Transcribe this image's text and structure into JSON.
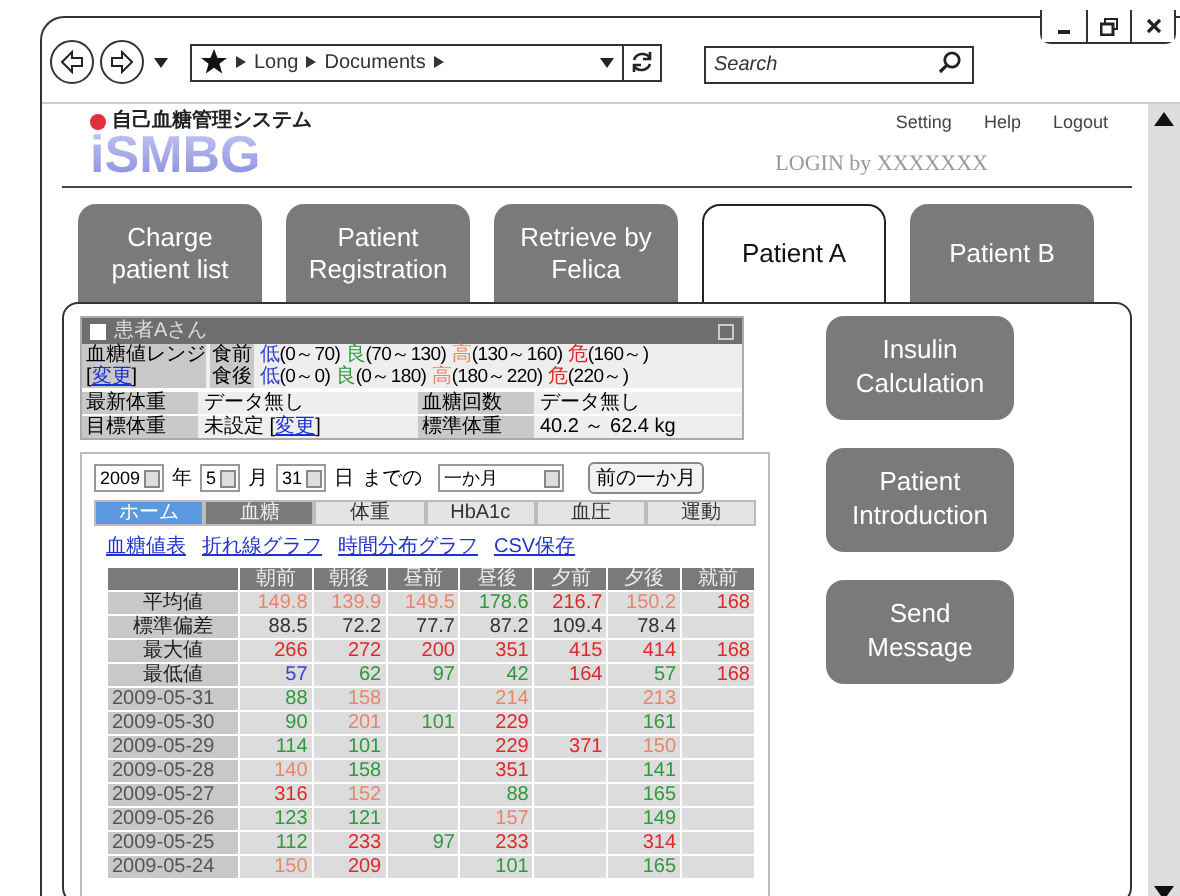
{
  "browser": {
    "breadcrumb": [
      "Long",
      "Documents"
    ],
    "search": {
      "placeholder": "Search"
    }
  },
  "header": {
    "subtitle": "自己血糖管理システム",
    "logo": "iSMBG",
    "links": [
      "Setting",
      "Help",
      "Logout"
    ],
    "login": "LOGIN by XXXXXXX"
  },
  "tabs": [
    {
      "label": "Charge patient list",
      "selected": false
    },
    {
      "label": "Patient Registration",
      "selected": false
    },
    {
      "label": "Retrieve by Felica",
      "selected": false
    },
    {
      "label": "Patient A",
      "selected": true
    },
    {
      "label": "Patient B",
      "selected": false
    }
  ],
  "patient_card": {
    "title": "患者Aさん",
    "range_label": "血糖値レンジ",
    "range_link": {
      "before": "[",
      "link": "変更",
      "after": "]"
    },
    "range_rows": [
      {
        "meal": "食前",
        "bands": [
          {
            "label": "低",
            "span": "(0～70)",
            "color": "#3344cc"
          },
          {
            "label": "良",
            "span": "(70～130)",
            "color": "#2e9a3a"
          },
          {
            "label": "高",
            "span": "(130～160)",
            "color": "#e8866a"
          },
          {
            "label": "危",
            "span": "(160～)",
            "color": "#e02828"
          }
        ]
      },
      {
        "meal": "食後",
        "bands": [
          {
            "label": "低",
            "span": "(0～0)",
            "color": "#3344cc"
          },
          {
            "label": "良",
            "span": "(0～180)",
            "color": "#2e9a3a"
          },
          {
            "label": "高",
            "span": "(180～220)",
            "color": "#e8866a"
          },
          {
            "label": "危",
            "span": "(220～)",
            "color": "#e02828"
          }
        ]
      }
    ],
    "info_rows": [
      {
        "label": "最新体重",
        "value": "データ無し",
        "label_2": "血糖回数",
        "value_2": "データ無し"
      },
      {
        "label": "目標体重",
        "value": "未設定",
        "link": {
          "before": "[",
          "link": "変更",
          "after": "]"
        },
        "label_2": "標準体重",
        "value_2": "40.2 ～ 62.4 kg"
      }
    ]
  },
  "date_filter": {
    "year": "2009",
    "year_unit": "年",
    "month": "5",
    "month_unit": "月",
    "day": "31",
    "day_unit": "日",
    "until": "までの",
    "period": "一か月",
    "prev_button": "前の一か月"
  },
  "sub_tabs": [
    {
      "label": "ホーム",
      "selected": false,
      "highlighted": true
    },
    {
      "label": "血糖",
      "selected": true,
      "highlighted": false
    },
    {
      "label": "体重",
      "selected": false,
      "highlighted": false
    },
    {
      "label": "HbA1c",
      "selected": false,
      "highlighted": false
    },
    {
      "label": "血圧",
      "selected": false,
      "highlighted": false
    },
    {
      "label": "運動",
      "selected": false,
      "highlighted": false
    }
  ],
  "view_links": [
    "血糖値表",
    "折れ線グラフ",
    "時間分布グラフ",
    "CSV保存"
  ],
  "table": {
    "columns": [
      "朝前",
      "朝後",
      "昼前",
      "昼後",
      "夕前",
      "夕後",
      "就前"
    ],
    "rows": [
      {
        "kind": "stat",
        "label": "平均値",
        "cells": [
          {
            "text": "149.8",
            "color": "#e8866a"
          },
          {
            "text": "139.9",
            "color": "#e8866a"
          },
          {
            "text": "149.5",
            "color": "#e8866a"
          },
          {
            "text": "178.6",
            "color": "#2e9a3a"
          },
          {
            "text": "216.7",
            "color": "#e02828"
          },
          {
            "text": "150.2",
            "color": "#e8866a"
          },
          {
            "text": "168",
            "color": "#e02828"
          }
        ]
      },
      {
        "kind": "stat",
        "label": "標準偏差",
        "cells": [
          {
            "text": "88.5",
            "color": "#333333"
          },
          {
            "text": "72.2",
            "color": "#333333"
          },
          {
            "text": "77.7",
            "color": "#333333"
          },
          {
            "text": "87.2",
            "color": "#333333"
          },
          {
            "text": "109.4",
            "color": "#333333"
          },
          {
            "text": "78.4",
            "color": "#333333"
          },
          null
        ]
      },
      {
        "kind": "stat",
        "label": "最大値",
        "cells": [
          {
            "text": "266",
            "color": "#e02828"
          },
          {
            "text": "272",
            "color": "#e02828"
          },
          {
            "text": "200",
            "color": "#e02828"
          },
          {
            "text": "351",
            "color": "#e02828"
          },
          {
            "text": "415",
            "color": "#e02828"
          },
          {
            "text": "414",
            "color": "#e02828"
          },
          {
            "text": "168",
            "color": "#e02828"
          }
        ]
      },
      {
        "kind": "stat",
        "label": "最低値",
        "cells": [
          {
            "text": "57",
            "color": "#3344cc"
          },
          {
            "text": "62",
            "color": "#2e9a3a"
          },
          {
            "text": "97",
            "color": "#2e9a3a"
          },
          {
            "text": "42",
            "color": "#2e9a3a"
          },
          {
            "text": "164",
            "color": "#e02828"
          },
          {
            "text": "57",
            "color": "#2e9a3a"
          },
          {
            "text": "168",
            "color": "#e02828"
          }
        ]
      },
      {
        "kind": "day",
        "label": "2009-05-31",
        "cells": [
          {
            "text": "88",
            "color": "#2e9a3a"
          },
          {
            "text": "158",
            "color": "#e8866a"
          },
          null,
          {
            "text": "214",
            "color": "#e8866a"
          },
          null,
          {
            "text": "213",
            "color": "#e8866a"
          },
          null
        ]
      },
      {
        "kind": "day",
        "label": "2009-05-30",
        "cells": [
          {
            "text": "90",
            "color": "#2e9a3a"
          },
          {
            "text": "201",
            "color": "#e8866a"
          },
          {
            "text": "101",
            "color": "#2e9a3a"
          },
          {
            "text": "229",
            "color": "#e02828"
          },
          null,
          {
            "text": "161",
            "color": "#2e9a3a"
          },
          null
        ]
      },
      {
        "kind": "day",
        "label": "2009-05-29",
        "cells": [
          {
            "text": "114",
            "color": "#2e9a3a"
          },
          {
            "text": "101",
            "color": "#2e9a3a"
          },
          null,
          {
            "text": "229",
            "color": "#e02828"
          },
          {
            "text": "371",
            "color": "#e02828"
          },
          {
            "text": "150",
            "color": "#e8866a"
          },
          null
        ]
      },
      {
        "kind": "day",
        "label": "2009-05-28",
        "cells": [
          {
            "text": "140",
            "color": "#e8866a"
          },
          {
            "text": "158",
            "color": "#2e9a3a"
          },
          null,
          {
            "text": "351",
            "color": "#e02828"
          },
          null,
          {
            "text": "141",
            "color": "#2e9a3a"
          },
          null
        ]
      },
      {
        "kind": "day",
        "label": "2009-05-27",
        "cells": [
          {
            "text": "316",
            "color": "#e02828"
          },
          {
            "text": "152",
            "color": "#e8866a"
          },
          null,
          {
            "text": "88",
            "color": "#2e9a3a"
          },
          null,
          {
            "text": "165",
            "color": "#2e9a3a"
          },
          null
        ]
      },
      {
        "kind": "day",
        "label": "2009-05-26",
        "cells": [
          {
            "text": "123",
            "color": "#2e9a3a"
          },
          {
            "text": "121",
            "color": "#2e9a3a"
          },
          null,
          {
            "text": "157",
            "color": "#e8866a"
          },
          null,
          {
            "text": "149",
            "color": "#2e9a3a"
          },
          null
        ]
      },
      {
        "kind": "day",
        "label": "2009-05-25",
        "cells": [
          {
            "text": "112",
            "color": "#2e9a3a"
          },
          {
            "text": "233",
            "color": "#e02828"
          },
          {
            "text": "97",
            "color": "#2e9a3a"
          },
          {
            "text": "233",
            "color": "#e02828"
          },
          null,
          {
            "text": "314",
            "color": "#e02828"
          },
          null
        ]
      },
      {
        "kind": "day",
        "label": "2009-05-24",
        "cells": [
          {
            "text": "150",
            "color": "#e8866a"
          },
          {
            "text": "209",
            "color": "#e02828"
          },
          null,
          {
            "text": "101",
            "color": "#2e9a3a"
          },
          null,
          {
            "text": "165",
            "color": "#2e9a3a"
          },
          null
        ]
      }
    ]
  },
  "actions": [
    "Insulin Calculation",
    "Patient Introduction",
    "Send Message"
  ]
}
